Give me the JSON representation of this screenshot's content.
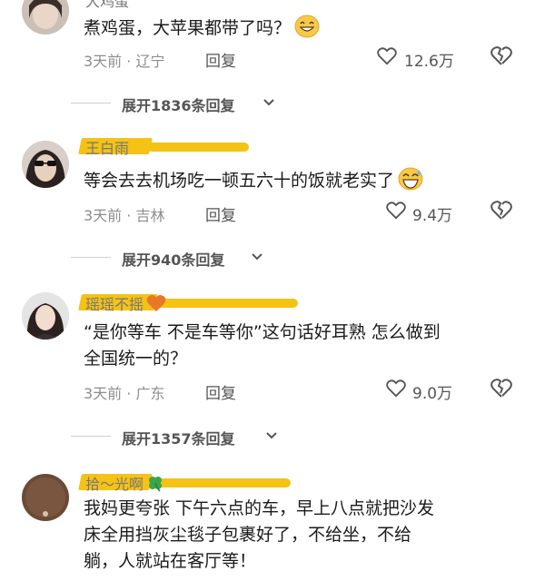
{
  "comments": [
    {
      "username": "大鸡蛋",
      "text_lines": [
        "煮鸡蛋，大苹果都带了吗？"
      ],
      "emoji": "grinning-emoji",
      "meta": "3天前 · 辽宁",
      "reply_label": "回复",
      "likes": "12.6万",
      "expand_label": "展开1836条回复"
    },
    {
      "username": "王白雨",
      "text_lines": [
        "等会去去机场吃一顿五六十的饭就老实了"
      ],
      "emoji": "sweat-smile-emoji",
      "meta": "3天前 · 吉林",
      "reply_label": "回复",
      "likes": "9.4万",
      "expand_label": "展开940条回复"
    },
    {
      "username": "瑶瑶不摇",
      "username_emoji": "orange-heart",
      "text_lines": [
        "“是你等车 不是车等你”这句话好耳熟 怎么做到",
        "全国统一的？"
      ],
      "meta": "3天前 · 广东",
      "reply_label": "回复",
      "likes": "9.0万",
      "expand_label": "展开1357条回复"
    },
    {
      "username": "拾～光啊",
      "username_emoji": "four-leaf-clover",
      "text_lines": [
        "我妈更夸张 下午六点的车，早上八点就把沙发",
        "床全用挡灰尘毯子包裹好了，不给坐，不给",
        "躺，人就站在客厅等！"
      ]
    }
  ],
  "colors": {
    "highlight": "#f5c216",
    "meta_gray": "#8e8e8e",
    "text": "#1b1b1b"
  }
}
